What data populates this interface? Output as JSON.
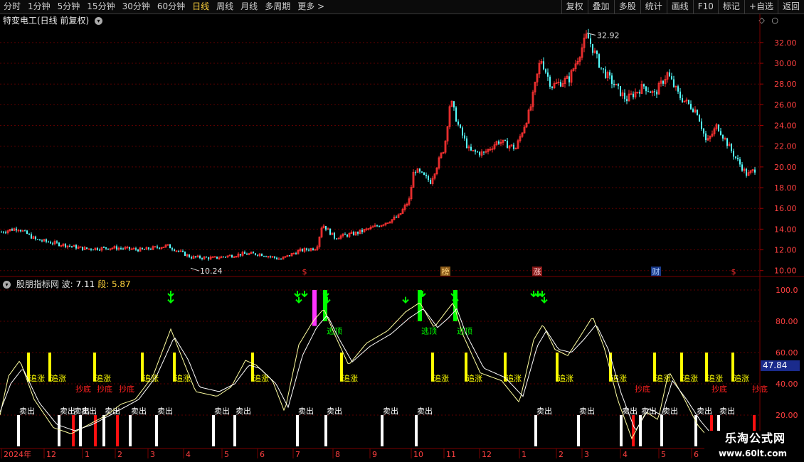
{
  "toolbar": {
    "periods": [
      "分时",
      "1分钟",
      "5分钟",
      "15分钟",
      "30分钟",
      "60分钟",
      "日线",
      "周线",
      "月线",
      "多周期",
      "更多 >"
    ],
    "active_period": "日线",
    "tools": [
      "复权",
      "叠加",
      "多股",
      "统计",
      "画线",
      "F10",
      "标记",
      "+自选",
      "返回"
    ]
  },
  "stock": {
    "title": "特变电工(日线 前复权)",
    "high_label": "32.92",
    "low_label": "10.24",
    "event_markers": [
      "$",
      "榜",
      "涨",
      "财",
      "$"
    ]
  },
  "indicator": {
    "name": "股朋指标网",
    "wave_label": "波:",
    "wave_value": "7.11",
    "seg_label": "段:",
    "seg_value": "5.87",
    "current_value": "47.84",
    "labels": {
      "buy": "追涨",
      "sell": "卖出",
      "bottom": "抄底",
      "escape": "逃顶"
    }
  },
  "price_axis": [
    "32.00",
    "30.00",
    "28.00",
    "26.00",
    "24.00",
    "22.00",
    "20.00",
    "18.00",
    "16.00",
    "14.00",
    "12.00",
    "10.00"
  ],
  "indicator_axis": [
    "100.0",
    "80.00",
    "60.00",
    "40.00",
    "20.00"
  ],
  "date_axis": [
    "2024年",
    "12",
    "1",
    "2",
    "3",
    "4",
    "5",
    "6",
    "7",
    "8",
    "9",
    "10",
    "11",
    "12",
    "1",
    "2",
    "3",
    "4",
    "5",
    "6"
  ],
  "watermark": {
    "line1": "乐淘公式网",
    "line2": "www.60lt.com"
  },
  "colors": {
    "up": "#ff3232",
    "down": "#54ffff",
    "yellow": "#ffff00",
    "green": "#00ff00",
    "magenta": "#ff33ff",
    "grid": "#5a0000"
  },
  "chart_data": [
    {
      "type": "candlestick",
      "title": "特变电工(日线 前复权)",
      "ylim": [
        9.5,
        33.5
      ],
      "anchor_points": [
        {
          "t": 0,
          "v": 13.7
        },
        {
          "t": 25,
          "v": 14.1
        },
        {
          "t": 50,
          "v": 13.0
        },
        {
          "t": 80,
          "v": 12.6
        },
        {
          "t": 120,
          "v": 12.1
        },
        {
          "t": 160,
          "v": 12.2
        },
        {
          "t": 200,
          "v": 12.0
        },
        {
          "t": 235,
          "v": 12.4
        },
        {
          "t": 268,
          "v": 11.3
        },
        {
          "t": 300,
          "v": 11.2
        },
        {
          "t": 340,
          "v": 11.6
        },
        {
          "t": 365,
          "v": 11.6
        },
        {
          "t": 395,
          "v": 11.1
        },
        {
          "t": 420,
          "v": 11.9
        },
        {
          "t": 445,
          "v": 12.2
        },
        {
          "t": 453,
          "v": 14.5
        },
        {
          "t": 470,
          "v": 13.2
        },
        {
          "t": 500,
          "v": 13.6
        },
        {
          "t": 530,
          "v": 14.3
        },
        {
          "t": 560,
          "v": 15.2
        },
        {
          "t": 575,
          "v": 16.8
        },
        {
          "t": 582,
          "v": 19.8
        },
        {
          "t": 605,
          "v": 18.6
        },
        {
          "t": 625,
          "v": 22.0
        },
        {
          "t": 633,
          "v": 26.5
        },
        {
          "t": 645,
          "v": 23.8
        },
        {
          "t": 660,
          "v": 21.5
        },
        {
          "t": 680,
          "v": 21.3
        },
        {
          "t": 700,
          "v": 22.5
        },
        {
          "t": 725,
          "v": 21.8
        },
        {
          "t": 745,
          "v": 25.5
        },
        {
          "t": 760,
          "v": 30.5
        },
        {
          "t": 775,
          "v": 27.8
        },
        {
          "t": 800,
          "v": 28.5
        },
        {
          "t": 825,
          "v": 32.7
        },
        {
          "t": 845,
          "v": 29.5
        },
        {
          "t": 880,
          "v": 26.5
        },
        {
          "t": 905,
          "v": 27.8
        },
        {
          "t": 920,
          "v": 27.0
        },
        {
          "t": 938,
          "v": 29.0
        },
        {
          "t": 955,
          "v": 26.8
        },
        {
          "t": 980,
          "v": 25.3
        },
        {
          "t": 993,
          "v": 22.3
        },
        {
          "t": 1008,
          "v": 24.0
        },
        {
          "t": 1030,
          "v": 21.3
        },
        {
          "t": 1050,
          "v": 19.2
        },
        {
          "t": 1062,
          "v": 19.8
        }
      ]
    },
    {
      "type": "line",
      "title": "股朋指标网",
      "ylim": [
        0,
        105
      ],
      "series": [
        {
          "name": "波",
          "values": [
            {
              "t": 0,
              "v": 20
            },
            {
              "t": 12,
              "v": 45
            },
            {
              "t": 28,
              "v": 55
            },
            {
              "t": 48,
              "v": 30
            },
            {
              "t": 75,
              "v": 12
            },
            {
              "t": 100,
              "v": 8
            },
            {
              "t": 125,
              "v": 14
            },
            {
              "t": 150,
              "v": 20
            },
            {
              "t": 170,
              "v": 27
            },
            {
              "t": 190,
              "v": 30
            },
            {
              "t": 215,
              "v": 45
            },
            {
              "t": 240,
              "v": 75
            },
            {
              "t": 260,
              "v": 52
            },
            {
              "t": 275,
              "v": 35
            },
            {
              "t": 305,
              "v": 32
            },
            {
              "t": 325,
              "v": 38
            },
            {
              "t": 345,
              "v": 55
            },
            {
              "t": 360,
              "v": 52
            },
            {
              "t": 383,
              "v": 42
            },
            {
              "t": 400,
              "v": 22
            },
            {
              "t": 420,
              "v": 65
            },
            {
              "t": 440,
              "v": 80
            },
            {
              "t": 455,
              "v": 88
            },
            {
              "t": 470,
              "v": 72
            },
            {
              "t": 490,
              "v": 52
            },
            {
              "t": 515,
              "v": 66
            },
            {
              "t": 545,
              "v": 74
            },
            {
              "t": 570,
              "v": 86
            },
            {
              "t": 590,
              "v": 92
            },
            {
              "t": 610,
              "v": 76
            },
            {
              "t": 625,
              "v": 85
            },
            {
              "t": 637,
              "v": 92
            },
            {
              "t": 650,
              "v": 72
            },
            {
              "t": 675,
              "v": 47
            },
            {
              "t": 705,
              "v": 42
            },
            {
              "t": 730,
              "v": 28
            },
            {
              "t": 750,
              "v": 68
            },
            {
              "t": 763,
              "v": 78
            },
            {
              "t": 780,
              "v": 62
            },
            {
              "t": 798,
              "v": 58
            },
            {
              "t": 815,
              "v": 70
            },
            {
              "t": 833,
              "v": 83
            },
            {
              "t": 850,
              "v": 62
            },
            {
              "t": 868,
              "v": 30
            },
            {
              "t": 888,
              "v": 5
            },
            {
              "t": 908,
              "v": 22
            },
            {
              "t": 925,
              "v": 17
            },
            {
              "t": 940,
              "v": 48
            },
            {
              "t": 960,
              "v": 32
            },
            {
              "t": 980,
              "v": 14
            },
            {
              "t": 995,
              "v": 6
            },
            {
              "t": 1020,
              "v": 3
            }
          ]
        },
        {
          "name": "段",
          "values": [
            {
              "t": 0,
              "v": 22
            },
            {
              "t": 15,
              "v": 40
            },
            {
              "t": 32,
              "v": 50
            },
            {
              "t": 55,
              "v": 28
            },
            {
              "t": 80,
              "v": 14
            },
            {
              "t": 105,
              "v": 10
            },
            {
              "t": 130,
              "v": 14
            },
            {
              "t": 155,
              "v": 20
            },
            {
              "t": 175,
              "v": 25
            },
            {
              "t": 195,
              "v": 30
            },
            {
              "t": 220,
              "v": 45
            },
            {
              "t": 245,
              "v": 70
            },
            {
              "t": 265,
              "v": 55
            },
            {
              "t": 280,
              "v": 38
            },
            {
              "t": 308,
              "v": 35
            },
            {
              "t": 330,
              "v": 40
            },
            {
              "t": 350,
              "v": 52
            },
            {
              "t": 365,
              "v": 50
            },
            {
              "t": 388,
              "v": 40
            },
            {
              "t": 405,
              "v": 25
            },
            {
              "t": 425,
              "v": 58
            },
            {
              "t": 445,
              "v": 76
            },
            {
              "t": 460,
              "v": 84
            },
            {
              "t": 475,
              "v": 70
            },
            {
              "t": 495,
              "v": 54
            },
            {
              "t": 520,
              "v": 64
            },
            {
              "t": 550,
              "v": 72
            },
            {
              "t": 575,
              "v": 82
            },
            {
              "t": 595,
              "v": 88
            },
            {
              "t": 615,
              "v": 76
            },
            {
              "t": 630,
              "v": 82
            },
            {
              "t": 642,
              "v": 88
            },
            {
              "t": 655,
              "v": 72
            },
            {
              "t": 680,
              "v": 50
            },
            {
              "t": 710,
              "v": 44
            },
            {
              "t": 735,
              "v": 32
            },
            {
              "t": 755,
              "v": 64
            },
            {
              "t": 768,
              "v": 74
            },
            {
              "t": 785,
              "v": 62
            },
            {
              "t": 803,
              "v": 60
            },
            {
              "t": 820,
              "v": 68
            },
            {
              "t": 838,
              "v": 78
            },
            {
              "t": 855,
              "v": 62
            },
            {
              "t": 873,
              "v": 34
            },
            {
              "t": 893,
              "v": 10
            },
            {
              "t": 912,
              "v": 24
            },
            {
              "t": 930,
              "v": 20
            },
            {
              "t": 945,
              "v": 42
            },
            {
              "t": 965,
              "v": 30
            },
            {
              "t": 985,
              "v": 16
            },
            {
              "t": 1000,
              "v": 8
            },
            {
              "t": 1020,
              "v": 5
            }
          ]
        }
      ],
      "signals": {
        "buy": [
          40,
          70,
          133,
          200,
          245,
          355,
          480,
          608,
          655,
          710,
          783,
          858,
          920,
          958,
          993,
          1030
        ],
        "sell": [
          26,
          83,
          103,
          113,
          146,
          183,
          220,
          300,
          330,
          418,
          458,
          537,
          585,
          753,
          813,
          873,
          900,
          930,
          978,
          1010
        ],
        "bottom_red": [
          103,
          134,
          165,
          890,
          1000,
          1060
        ],
        "bottom_labels": [
          117,
          147,
          178,
          903,
          1011,
          1068
        ],
        "escape_green": [
          457,
          590,
          640
        ],
        "escape_labels": [
          470,
          603,
          653
        ],
        "magenta_bars": [
          {
            "t": 442,
            "v": 92
          }
        ],
        "green_arrows_top": [
          240,
          418,
          428,
          458,
          594,
          638,
          750,
          756,
          762
        ],
        "green_arrows_low": [
          240,
          420,
          460,
          570,
          640,
          765
        ]
      }
    }
  ]
}
